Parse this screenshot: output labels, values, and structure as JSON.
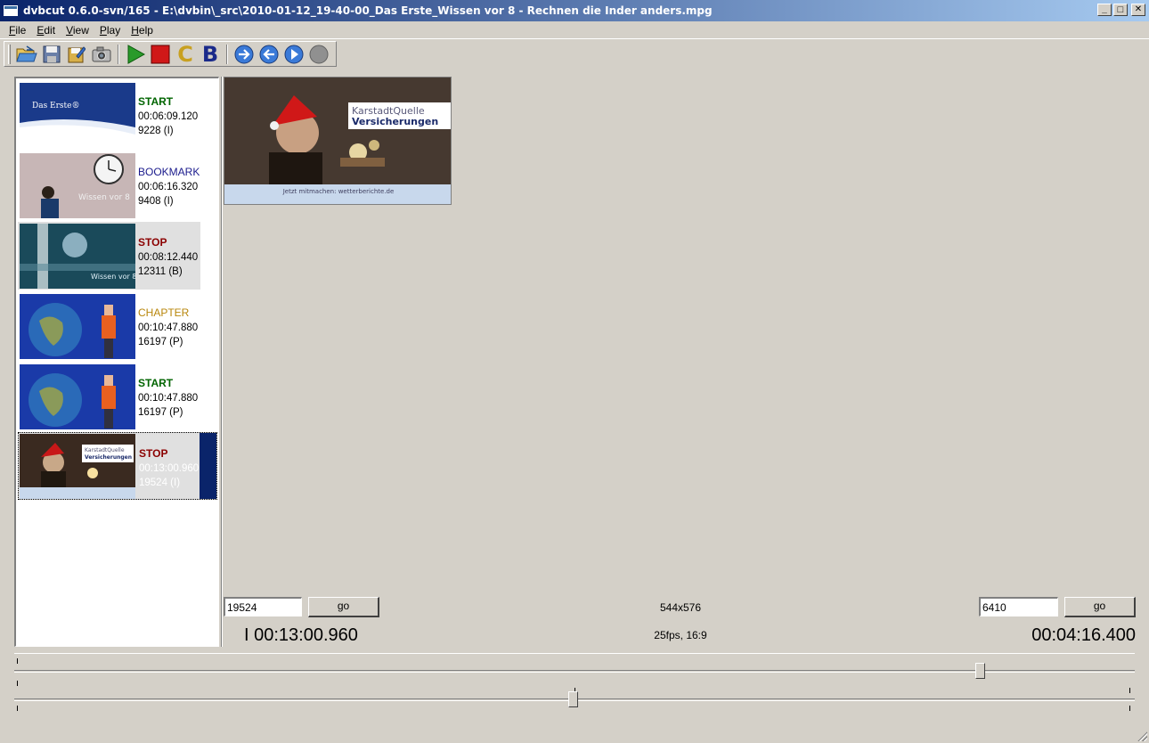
{
  "window": {
    "title": "dvbcut 0.6.0-svn/165 - E:\\dvbin\\_src\\2010-01-12_19-40-00_Das Erste_Wissen vor 8 - Rechnen die Inder anders.mpg",
    "minimize": "_",
    "maximize": "□",
    "close": "✕"
  },
  "menu": {
    "file": {
      "underline": "F",
      "rest": "ile"
    },
    "edit": {
      "underline": "E",
      "rest": "dit"
    },
    "view": {
      "underline": "V",
      "rest": "iew"
    },
    "play": {
      "underline": "P",
      "rest": "lay"
    },
    "help": {
      "underline": "H",
      "rest": "elp"
    }
  },
  "toolbar": {
    "chapter_letter": "C",
    "bookmark_letter": "B"
  },
  "cut_list": [
    {
      "type": "START",
      "time": "00:06:09.120",
      "frame": "9228 (I)",
      "thumb_text": "Das Erste®"
    },
    {
      "type": "BOOKMARK",
      "time": "00:06:16.320",
      "frame": "9408 (I)",
      "thumb_text": "Wissen vor 8"
    },
    {
      "type": "STOP",
      "time": "00:08:12.440",
      "frame": "12311 (B)",
      "thumb_text": "Wissen vor 8"
    },
    {
      "type": "CHAPTER",
      "time": "00:10:47.880",
      "frame": "16197 (P)",
      "thumb_text": ""
    },
    {
      "type": "START",
      "time": "00:10:47.880",
      "frame": "16197 (P)",
      "thumb_text": ""
    },
    {
      "type": "STOP",
      "time": "00:13:00.960",
      "frame": "19524 (I)",
      "thumb_text": "KarstadtQuelle Versicherungen"
    }
  ],
  "preview": {
    "logo_line1": "KarstadtQuelle",
    "logo_line2": "Versicherungen",
    "caption": "Jetzt mitmachen: wetterberichte.de"
  },
  "left_frame": {
    "value": "19524",
    "go": "go",
    "time": "I 00:13:00.960"
  },
  "right_frame": {
    "value": "6410",
    "go": "go",
    "time": "00:04:16.400"
  },
  "video_info": {
    "resolution": "544x576",
    "format": "25fps, 16:9"
  },
  "sliders": {
    "top_position": 0.862,
    "bottom_position": 0.499
  }
}
